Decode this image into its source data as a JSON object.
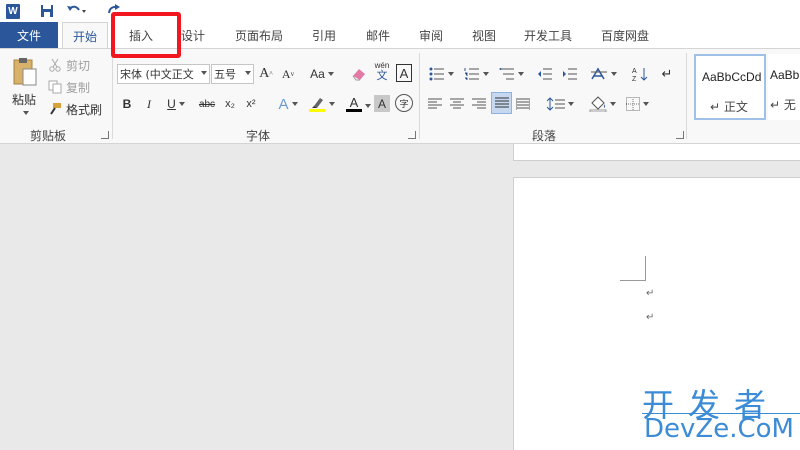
{
  "qat": {
    "word_icon_label": "W",
    "icons": [
      "word-icon",
      "save-icon",
      "undo-icon",
      "redo-icon"
    ]
  },
  "tabs": [
    {
      "label": "文件",
      "name": "tab-file"
    },
    {
      "label": "开始",
      "name": "tab-home",
      "active": true
    },
    {
      "label": "插入",
      "name": "tab-insert",
      "highlighted": true
    },
    {
      "label": "设计",
      "name": "tab-design"
    },
    {
      "label": "页面布局",
      "name": "tab-page-layout"
    },
    {
      "label": "引用",
      "name": "tab-references"
    },
    {
      "label": "邮件",
      "name": "tab-mailings"
    },
    {
      "label": "审阅",
      "name": "tab-review"
    },
    {
      "label": "视图",
      "name": "tab-view"
    },
    {
      "label": "开发工具",
      "name": "tab-developer"
    },
    {
      "label": "百度网盘",
      "name": "tab-baidu-netdisk"
    }
  ],
  "clipboard": {
    "paste_label": "粘贴",
    "cut_label": "剪切",
    "copy_label": "复制",
    "format_painter_label": "格式刷",
    "group_label": "剪贴板"
  },
  "font": {
    "font_name": "宋体 (中文正文",
    "font_size": "五号",
    "grow_label": "A",
    "shrink_label": "A",
    "case_label": "Aa",
    "phonetic_label": "wén",
    "border_char_label": "A",
    "bold_label": "B",
    "italic_label": "I",
    "underline_label": "U",
    "strike_label": "abc",
    "subscript_label": "x₂",
    "superscript_label": "x²",
    "effects_label": "A",
    "color_label": "A",
    "shading_label": "A",
    "enclose_label": "字",
    "group_label": "字体"
  },
  "paragraph": {
    "group_label": "段落"
  },
  "styles": {
    "items": [
      {
        "sample": "AaBbCcDd",
        "name": "↵ 正文"
      },
      {
        "sample": "AaBb",
        "name": "↵ 无"
      }
    ]
  },
  "document": {
    "para_marks": [
      "↵",
      "↵"
    ]
  },
  "watermark": {
    "cn": "开发者",
    "en": "DevZe.CoM"
  },
  "colors": {
    "accent": "#2b579a",
    "highlight_box": "#f2171e",
    "watermark": "#3b8bd6",
    "font_color_bar": "#000000",
    "highlight_bar": "#ffff00"
  }
}
